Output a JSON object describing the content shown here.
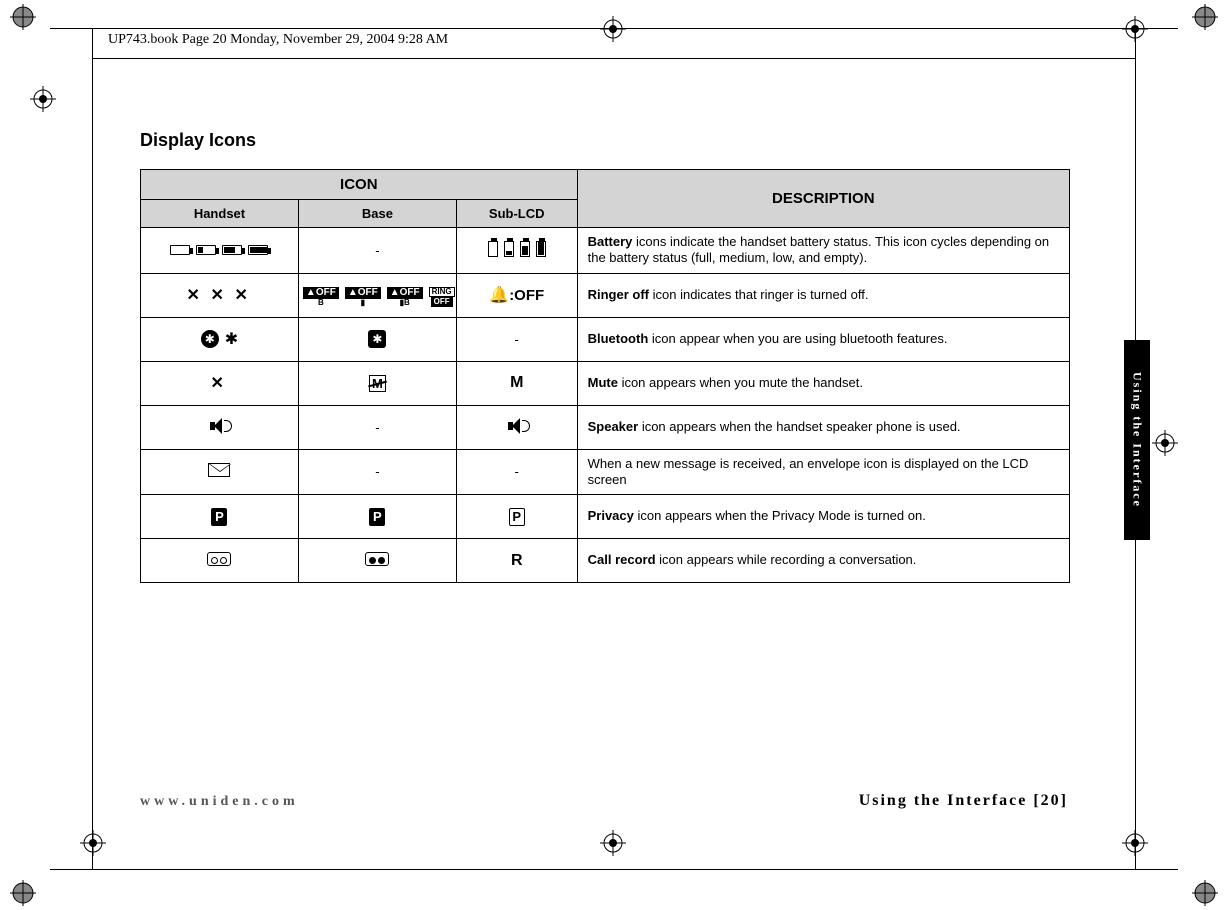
{
  "header_line": "UP743.book  Page 20  Monday, November 29, 2004  9:28 AM",
  "section_title": "Display Icons",
  "side_tab": "Using the Interface",
  "footer_left": "www.uniden.com",
  "footer_right": "Using the Interface [20]",
  "table": {
    "head_icon": "ICON",
    "head_desc": "DESCRIPTION",
    "sub_handset": "Handset",
    "sub_base": "Base",
    "sub_sublcd": "Sub-LCD",
    "rows": [
      {
        "handset_dash": "",
        "base_dash": "-",
        "sub_dash": "",
        "desc_bold": "Battery",
        "desc_rest": " icons indicate the handset battery status. This icon cycles depending on the battery status (full, medium, low, and empty)."
      },
      {
        "handset_dash": "",
        "base_dash": "",
        "sub_dash": "",
        "sub_off_label": ":OFF",
        "ring_label": "RING",
        "off_label": "OFF",
        "bell_off_label": "▲OFF",
        "sub_b": "B",
        "sub_h": "▮",
        "sub_hb": "▮B",
        "desc_bold": "Ringer off",
        "desc_rest": " icon indicates that ringer is turned off."
      },
      {
        "handset_dash": "",
        "base_dash": "",
        "sub_dash": "-",
        "desc_bold": "Bluetooth",
        "desc_rest": " icon appear when you are using bluetooth features."
      },
      {
        "handset_dash": "",
        "base_dash": "",
        "sub_dash": "",
        "m_label": "M",
        "desc_bold": "Mute",
        "desc_rest": " icon appears when you mute the handset."
      },
      {
        "handset_dash": "",
        "base_dash": "-",
        "sub_dash": "",
        "desc_bold": "Speaker",
        "desc_rest": " icon appears when the handset speaker phone is used."
      },
      {
        "handset_dash": "",
        "base_dash": "-",
        "sub_dash": "-",
        "desc_bold": "",
        "desc_rest": "When a new message is received, an envelope icon is displayed on the LCD screen"
      },
      {
        "handset_dash": "",
        "base_dash": "",
        "sub_dash": "",
        "p_label": "P",
        "desc_bold": "Privacy",
        "desc_rest": " icon appears when the Privacy Mode is turned on."
      },
      {
        "handset_dash": "",
        "base_dash": "",
        "sub_dash": "",
        "r_label": "R",
        "desc_bold": "Call record",
        "desc_rest": " icon appears while recording a conversation."
      }
    ]
  }
}
